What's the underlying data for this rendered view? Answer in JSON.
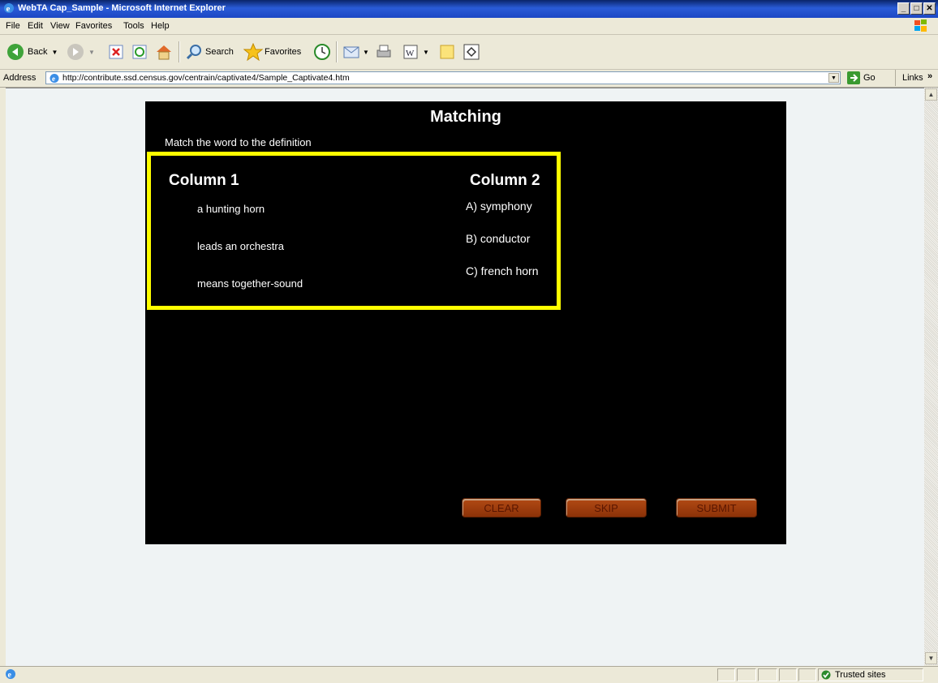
{
  "window": {
    "title": "WebTA Cap_Sample - Microsoft Internet Explorer",
    "minimize": "_",
    "maximize": "□",
    "close": "✕"
  },
  "menu": [
    "File",
    "Edit",
    "View",
    "Favorites",
    "Tools",
    "Help"
  ],
  "toolbar": {
    "back": "Back",
    "search": "Search",
    "favorites": "Favorites"
  },
  "address": {
    "label": "Address",
    "url": "http://contribute.ssd.census.gov/centrain/captivate4/Sample_Captivate4.htm",
    "go": "Go",
    "links": "Links"
  },
  "quiz": {
    "title": "Matching",
    "instruction": "Match the word to the definition",
    "column1_header": "Column 1",
    "column2_header": "Column 2",
    "column1": [
      "a hunting horn",
      "leads an orchestra",
      "means together-sound"
    ],
    "column2": [
      "A) symphony",
      "B) conductor",
      "C) french horn"
    ],
    "clear": "CLEAR",
    "skip": "SKIP",
    "submit": "SUBMIT",
    "frame_color": "#ffff00",
    "button_color": "#a8400e"
  },
  "status": {
    "zone": "Trusted sites"
  },
  "icons": {
    "app": "ie-icon",
    "back": "back-arrow-icon",
    "forward": "forward-arrow-icon",
    "stop": "stop-icon",
    "refresh": "refresh-icon",
    "home": "home-icon",
    "search": "search-icon",
    "favorites": "star-icon",
    "history": "history-icon",
    "mail": "mail-icon",
    "print": "print-icon",
    "edit": "word-icon",
    "discuss": "note-icon",
    "messenger": "messenger-icon",
    "go": "go-arrow-icon",
    "trusted": "check-shield-icon"
  }
}
